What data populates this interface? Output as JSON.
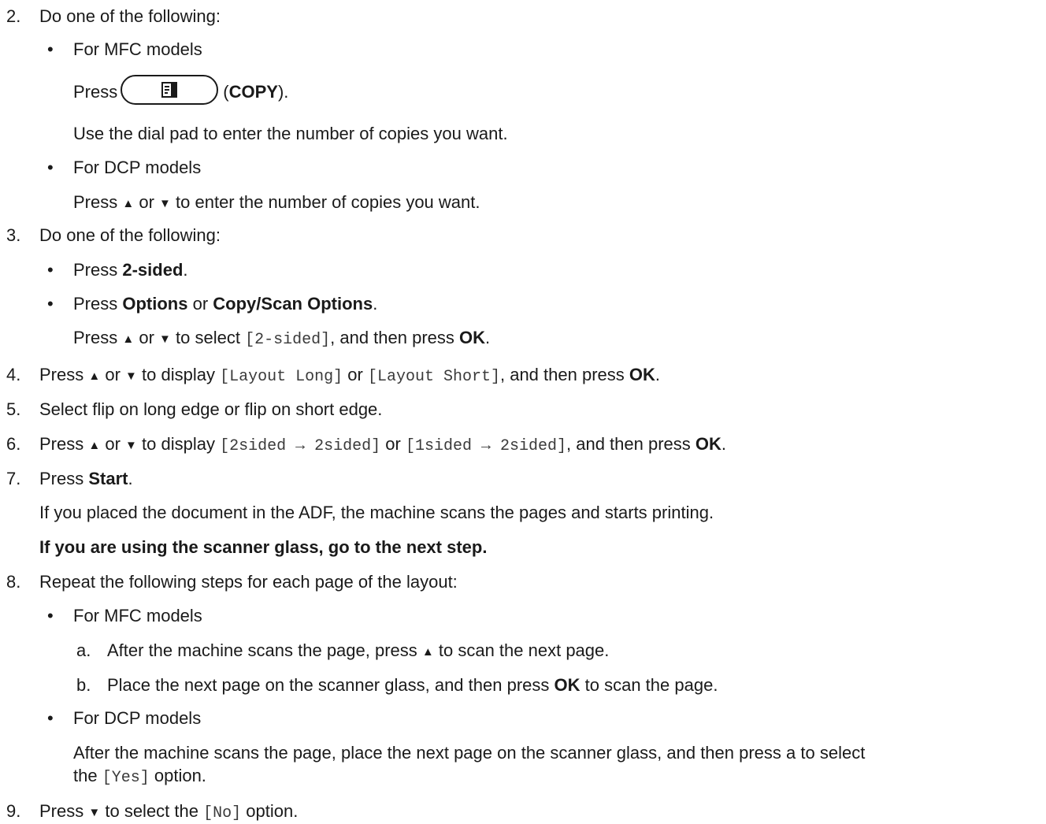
{
  "steps": {
    "s2": {
      "num": "2.",
      "text": "Do one of the following:"
    },
    "s2_mfc": {
      "bullet": "•",
      "title": "For MFC models",
      "press": "Press",
      "open": "(",
      "copy": "COPY",
      "close": ").",
      "dial": "Use the dial pad to enter the number of copies you want."
    },
    "s2_dcp": {
      "bullet": "•",
      "title": "For DCP models",
      "press": "Press",
      "up": "▲",
      "or": "or",
      "down": "▼",
      "rest": "to enter the number of copies you want."
    },
    "s3": {
      "num": "3.",
      "text": "Do one of the following:"
    },
    "s3_b1": {
      "bullet": "•",
      "press": "Press",
      "label": "2-sided",
      "end": "."
    },
    "s3_b2": {
      "bullet": "•",
      "press": "Press",
      "opt1": "Options",
      "or": "or",
      "opt2": "Copy/Scan Options",
      "end": ".",
      "l2_press": "Press",
      "l2_up": "▲",
      "l2_or": "or",
      "l2_down": "▼",
      "l2_mid": "to select",
      "l2_code": "[2-sided]",
      "l2_then": ", and then press",
      "l2_ok": "OK",
      "l2_end": "."
    },
    "s4": {
      "num": "4.",
      "press": "Press",
      "up": "▲",
      "or": "or",
      "down": "▼",
      "mid": "to display",
      "code1": "[Layout Long]",
      "or2": "or",
      "code2": "[Layout Short]",
      "then": ", and then press",
      "ok": "OK",
      "end": "."
    },
    "s5": {
      "num": "5.",
      "text": "Select flip on long edge or flip on short edge."
    },
    "s6": {
      "num": "6.",
      "press": "Press",
      "up": "▲",
      "or": "or",
      "down": "▼",
      "mid": "to display",
      "code1": "[2sided → 2sided]",
      "or2": "or",
      "code2": "[1sided → 2sided]",
      "then": ", and then press",
      "ok": "OK",
      "end": "."
    },
    "s7": {
      "num": "7.",
      "press": "Press",
      "start": "Start",
      "end": ".",
      "adf": "If you placed the document in the ADF, the machine scans the pages and starts printing.",
      "glass": "If you are using the scanner glass, go to the next step."
    },
    "s8": {
      "num": "8.",
      "text": "Repeat the following steps for each page of the layout:",
      "mfc_bullet": "•",
      "mfc_title": "For MFC models",
      "a_num": "a.",
      "a_text": "After the machine scans the page, press",
      "a_up": "▲",
      "a_end": "to scan the next page.",
      "b_num": "b.",
      "b_text": "Place the next page on the scanner glass, and then press",
      "b_ok": "OK",
      "b_end": "to scan the page.",
      "dcp_bullet": "•",
      "dcp_title": "For DCP models",
      "dcp_l1": "After the machine scans the page, place the next page on the scanner glass, and then press a to select",
      "dcp_l2a": "the",
      "dcp_code": "[Yes]",
      "dcp_l2b": "option."
    },
    "s9": {
      "num": "9.",
      "press": "Press",
      "down": "▼",
      "mid": "to select the",
      "code": "[No]",
      "end": "option."
    }
  },
  "icons": {
    "copy_button_icon": "copy-document-icon"
  },
  "colors": {
    "text": "#1a1a1a",
    "mono_text": "#3a3a3a"
  }
}
